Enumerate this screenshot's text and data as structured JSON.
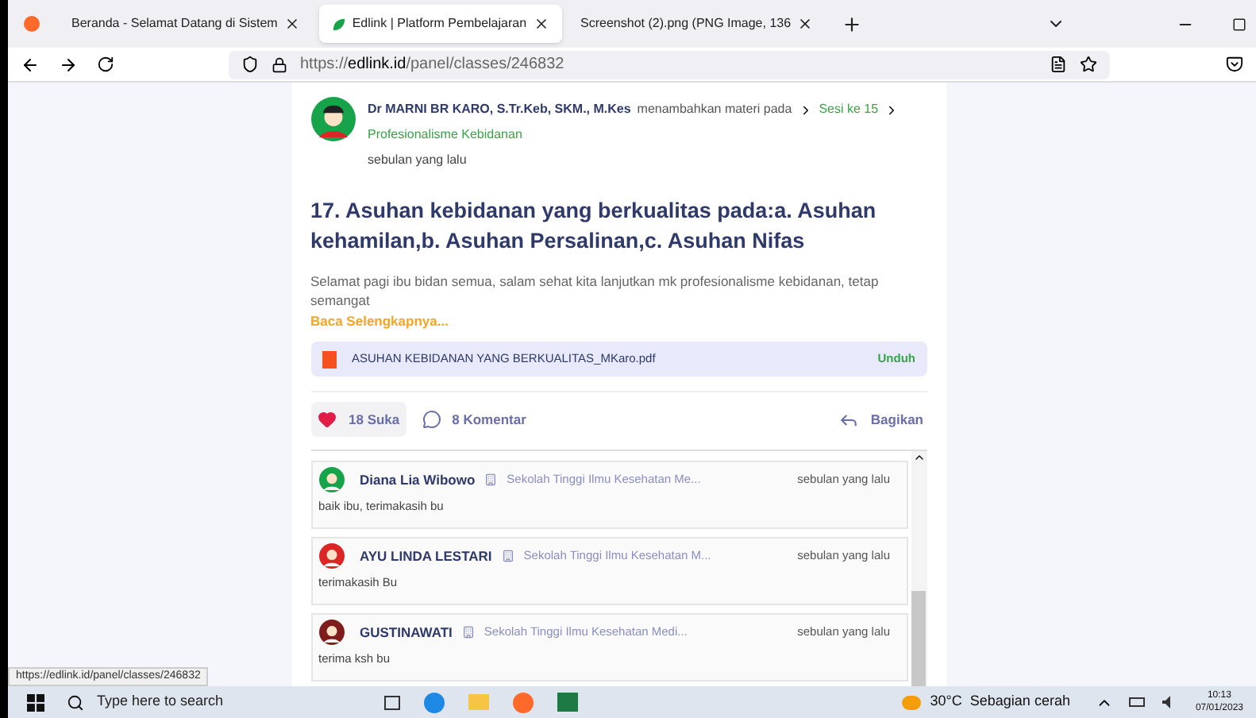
{
  "tabs": [
    {
      "label": "Beranda - Selamat Datang di Sistem",
      "selected": false
    },
    {
      "label": "Edlink | Platform Pembelajaran",
      "selected": true
    },
    {
      "label": "Screenshot (2).png (PNG Image, 136",
      "selected": false
    }
  ],
  "address": {
    "prefix": "https://",
    "domain": "edlink.id",
    "path": "/panel/classes/246832"
  },
  "post": {
    "author": "Dr MARNI BR KARO, S.Tr.Keb, SKM., M.Kes",
    "action": "menambahkan materi pada",
    "crumbs": [
      "Sesi ke 15",
      "Profesionalisme Kebidanan"
    ],
    "time": "sebulan yang lalu",
    "title": "17. Asuhan kebidanan yang berkualitas pada:a. Asuhan kehamilan,b. Asuhan Persalinan,c. Asuhan Nifas",
    "body": "Selamat pagi ibu bidan semua, salam sehat kita lanjutkan mk profesionalisme kebidanan, tetap semangat",
    "more": "Baca Selengkapnya...",
    "file": {
      "name": "ASUHAN KEBIDANAN YANG BERKUALITAS_MKaro.pdf",
      "action": "Unduh"
    },
    "likes": {
      "label": "18 Suka",
      "liked": true
    },
    "comments_label": "8 Komentar",
    "share": "Bagikan"
  },
  "comments": [
    {
      "name": "Diana Lia Wibowo",
      "school": "Sekolah Tinggi Ilmu Kesehatan Me...",
      "time": "sebulan yang lalu",
      "text": "baik ibu, terimakasih bu",
      "color": "#16a34a"
    },
    {
      "name": "AYU LINDA LESTARI",
      "school": "Sekolah Tinggi Ilmu Kesehatan M...",
      "time": "sebulan yang lalu",
      "text": "terimakasih Bu",
      "color": "#dc2626"
    },
    {
      "name": "GUSTINAWATI",
      "school": "Sekolah Tinggi Ilmu Kesehatan Medi...",
      "time": "sebulan yang lalu",
      "text": "terima ksh bu",
      "color": "#7f1d1d"
    }
  ],
  "status_url": "https://edlink.id/panel/classes/246832",
  "taskbar": {
    "search": "Type here to search",
    "weather": "30°C  Sebagian cerah",
    "time": "10:13",
    "date": "07/01/2023"
  }
}
